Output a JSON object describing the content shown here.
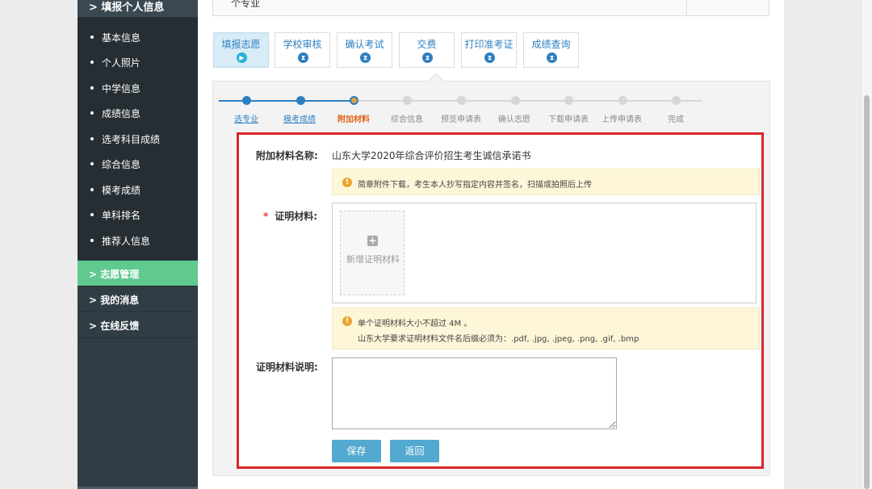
{
  "sidebar": {
    "top_label": "> 填报个人信息",
    "sub_items": [
      "基本信息",
      "个人照片",
      "中学信息",
      "成绩信息",
      "选考科目成绩",
      "综合信息",
      "模考成绩",
      "单科排名",
      "推荐人信息"
    ],
    "groups": [
      {
        "label": "> 志愿管理",
        "active": true
      },
      {
        "label": "> 我的消息",
        "active": false
      },
      {
        "label": "> 在线反馈",
        "active": false
      }
    ]
  },
  "header": {
    "box_text": "个专业"
  },
  "tabs": [
    {
      "label": "填报志愿",
      "icon": "play-icon",
      "active": true
    },
    {
      "label": "学校审核",
      "icon": "hourglass-icon",
      "active": false
    },
    {
      "label": "确认考试",
      "icon": "hourglass-icon",
      "active": false
    },
    {
      "label": "交费",
      "icon": "hourglass-icon",
      "active": false
    },
    {
      "label": "打印准考证",
      "icon": "hourglass-icon",
      "active": false
    },
    {
      "label": "成绩查询",
      "icon": "hourglass-icon",
      "active": false
    }
  ],
  "steps": [
    {
      "label": "选专业",
      "state": "done"
    },
    {
      "label": "模考成绩",
      "state": "done"
    },
    {
      "label": "附加材料",
      "state": "current"
    },
    {
      "label": "综合信息",
      "state": "todo"
    },
    {
      "label": "预览申请表",
      "state": "todo"
    },
    {
      "label": "确认志愿",
      "state": "todo"
    },
    {
      "label": "下载申请表",
      "state": "todo"
    },
    {
      "label": "上传申请表",
      "state": "todo"
    },
    {
      "label": "完成",
      "state": "todo"
    }
  ],
  "form": {
    "material_name_label": "附加材料名称:",
    "material_name_value": "山东大学2020年综合评价招生考生诚信承诺书",
    "notice1": "简章附件下载，考生本人抄写指定内容并签名，扫描或拍照后上传",
    "proof_label": "证明材料:",
    "required_mark": "*",
    "upload_label": "新增证明材料",
    "notice2_line1": "单个证明材料大小不超过 4M 。",
    "notice2_line2": "山东大学要求证明材料文件名后缀必须为：.pdf, .jpg, .jpeg, .png, .gif, .bmp",
    "desc_label": "证明材料说明:",
    "desc_value": "",
    "save_label": "保存",
    "back_label": "返回"
  },
  "colors": {
    "sidebar_bg": "#303d45",
    "sidebar_active": "#5fc98f",
    "link_blue": "#2e7fc1",
    "current_orange": "#e0651b",
    "highlight_red": "#d8262b",
    "button_blue": "#53a9cf"
  }
}
